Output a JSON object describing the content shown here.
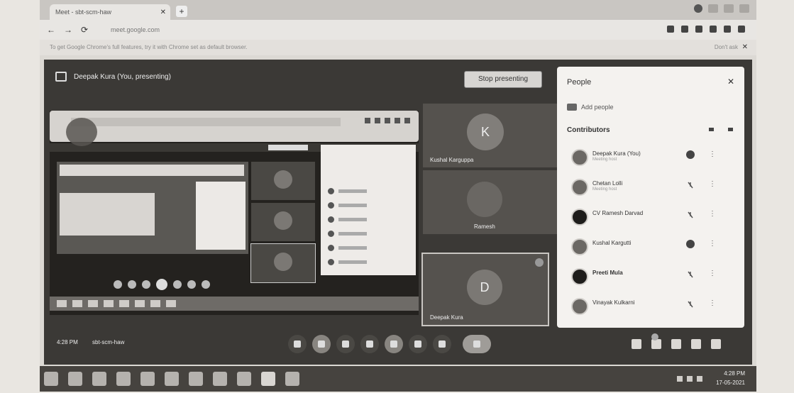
{
  "browser": {
    "tab_title": "Meet - sbt-scm-haw",
    "tab_close": "✕",
    "new_tab": "+",
    "url": "meet.google.com",
    "back": "←",
    "forward": "→",
    "reload": "⟳",
    "infobar_text": "To get Google Chrome's full features, try it with Chrome set as default browser.",
    "infobar_right": "Don't ask",
    "infobar_close": "✕"
  },
  "meet": {
    "presenting_label": "Deepak Kura (You, presenting)",
    "stop_presenting": "Stop presenting",
    "tiles": [
      {
        "initial": "K",
        "name": "Kushal Karguppa"
      },
      {
        "initial": "",
        "name": "Ramesh"
      },
      {
        "initial": "D",
        "name": "Deepak Kura"
      }
    ],
    "people": {
      "title": "People",
      "close": "✕",
      "add_people": "Add people",
      "section": "Contributors",
      "rows": [
        {
          "name": "Deepak Kura (You)",
          "sub": "Meeting host",
          "mic": "on",
          "more": "⋮"
        },
        {
          "name": "Chetan Lolli",
          "sub": "Meeting host",
          "mic": "off",
          "more": "⋮"
        },
        {
          "name": "CV Ramesh Darvad",
          "sub": "",
          "mic": "off",
          "more": "⋮"
        },
        {
          "name": "Kushal Kargutti",
          "sub": "",
          "mic": "on",
          "more": "⋮"
        },
        {
          "name": "Preeti Mula",
          "sub": "",
          "mic": "off",
          "more": "⋮"
        },
        {
          "name": "Vinayak Kulkarni",
          "sub": "",
          "mic": "off",
          "more": "⋮"
        }
      ]
    },
    "controls": {
      "time": "4:28 PM",
      "meeting_code": "sbt-scm-haw"
    }
  },
  "taskbar": {
    "time": "4:28 PM",
    "date": "17-05-2021"
  }
}
